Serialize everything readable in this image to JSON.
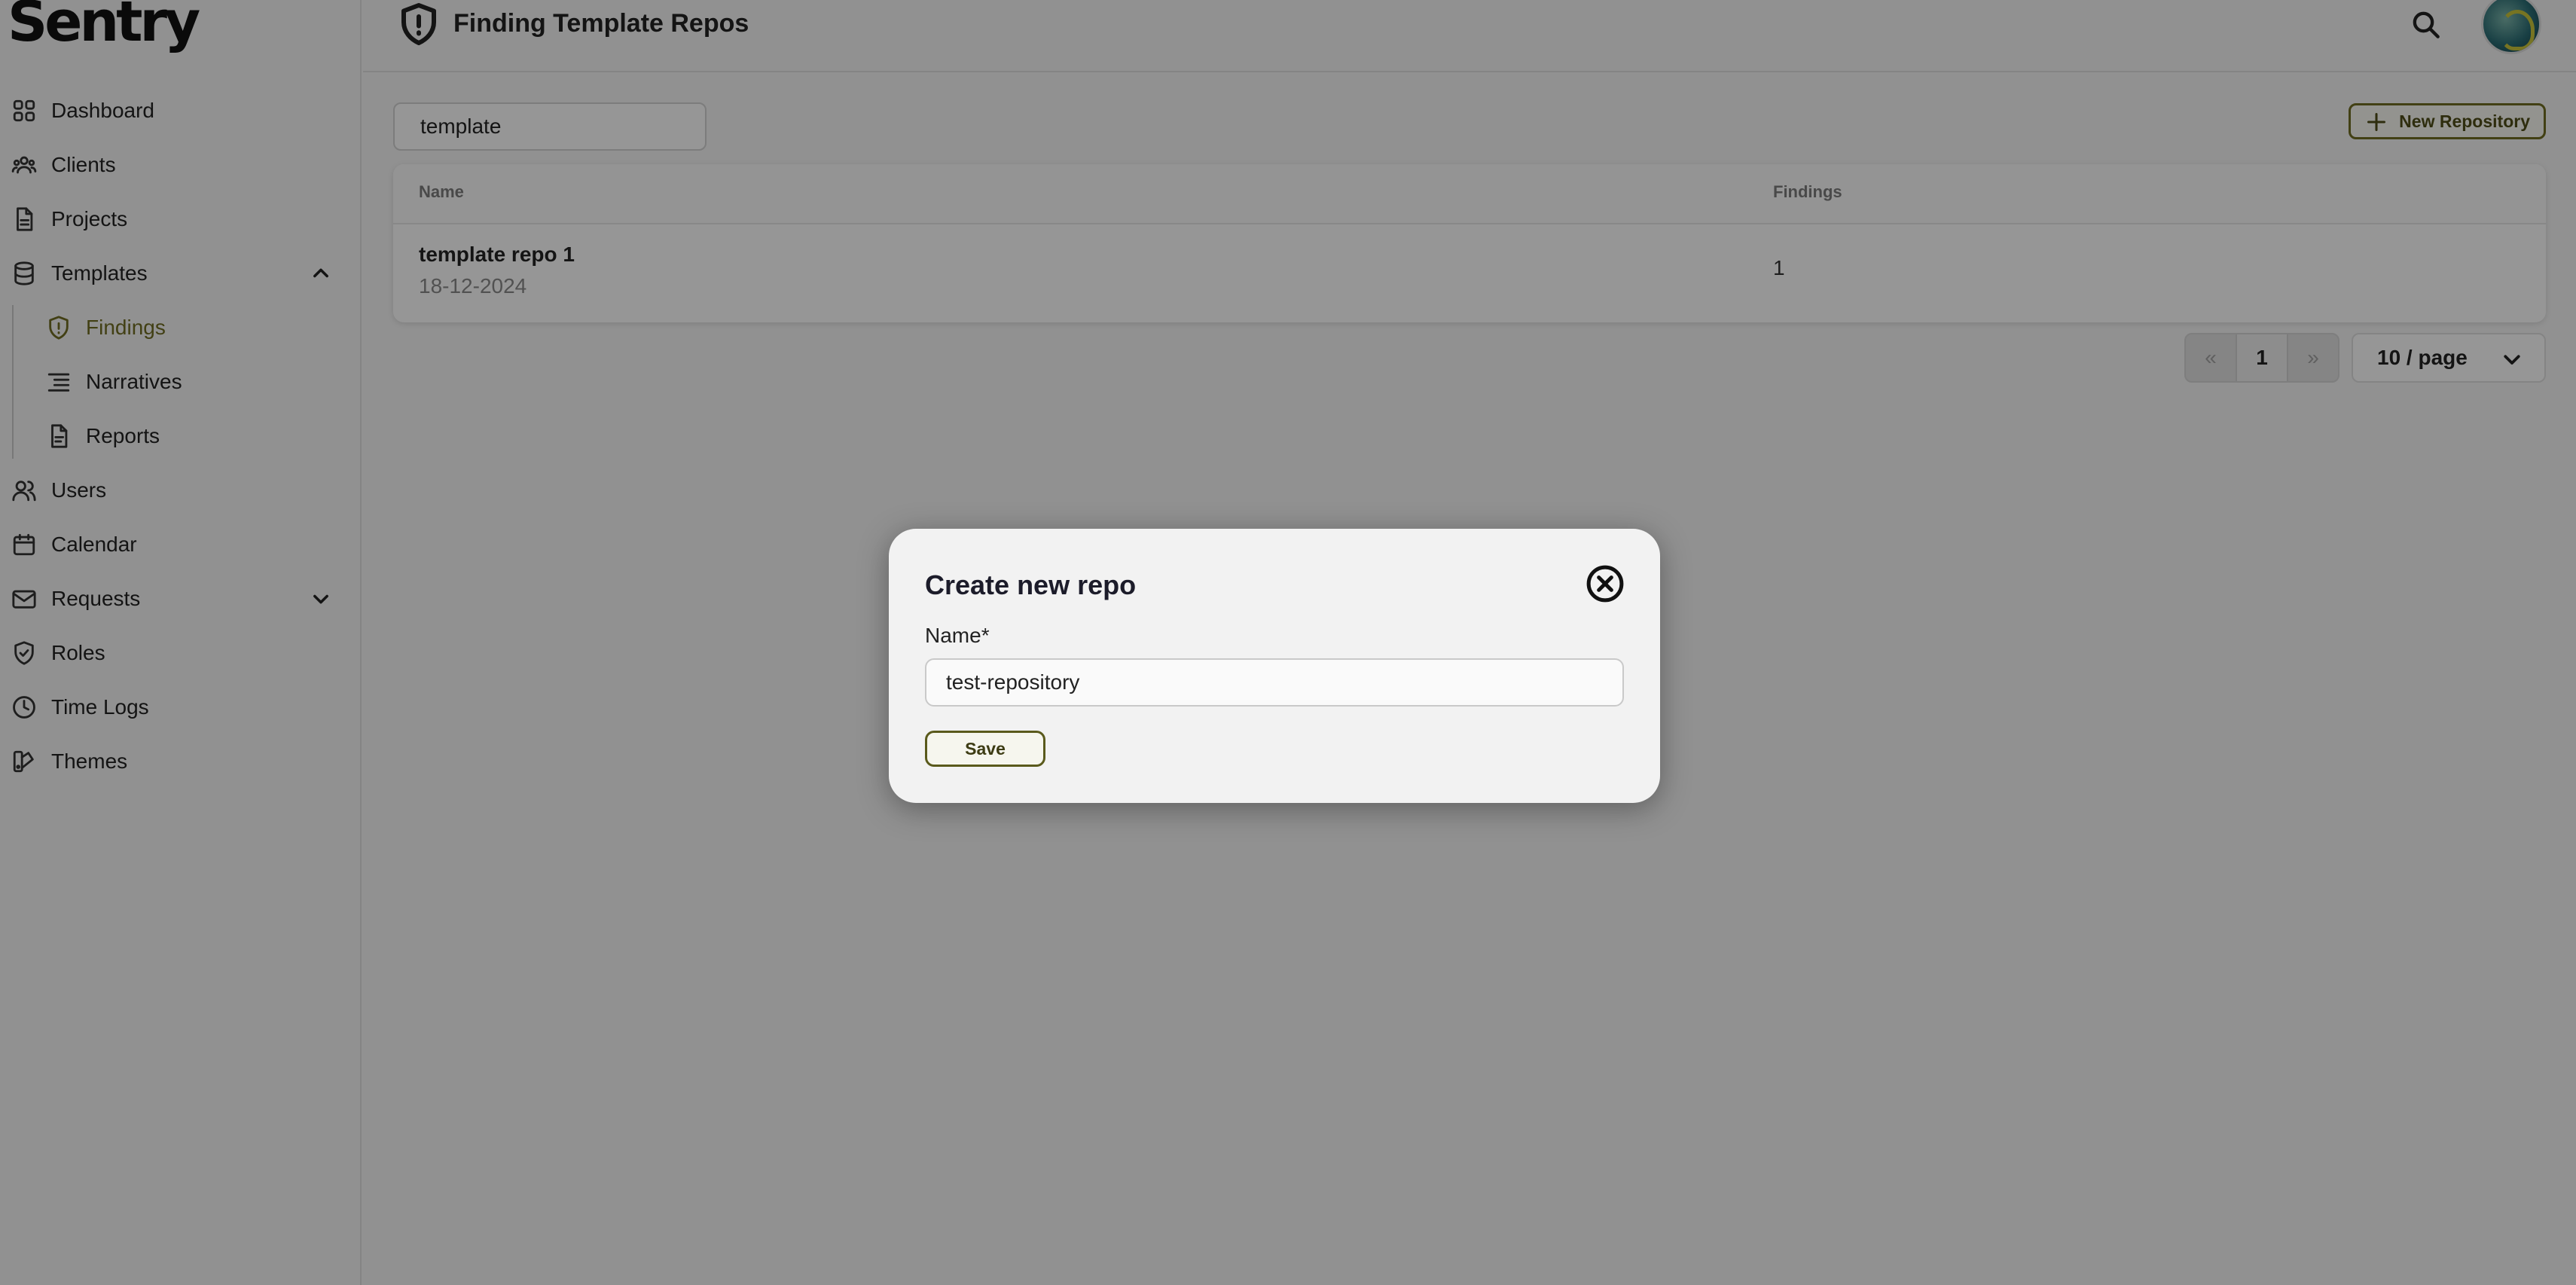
{
  "app": {
    "logo": "Sentry",
    "logo_mark": "™"
  },
  "sidebar": {
    "items": [
      {
        "label": "Dashboard",
        "icon": "grid-icon"
      },
      {
        "label": "Clients",
        "icon": "users-group-icon"
      },
      {
        "label": "Projects",
        "icon": "document-icon"
      },
      {
        "label": "Templates",
        "icon": "database-icon",
        "expanded": true
      },
      {
        "label": "Users",
        "icon": "users-icon"
      },
      {
        "label": "Calendar",
        "icon": "calendar-icon"
      },
      {
        "label": "Requests",
        "icon": "mail-icon",
        "expanded": false
      },
      {
        "label": "Roles",
        "icon": "shield-check-icon"
      },
      {
        "label": "Time Logs",
        "icon": "clock-icon"
      },
      {
        "label": "Themes",
        "icon": "palette-icon"
      }
    ],
    "template_children": [
      {
        "label": "Findings",
        "icon": "shield-alert-icon",
        "active": true
      },
      {
        "label": "Narratives",
        "icon": "list-icon"
      },
      {
        "label": "Reports",
        "icon": "report-icon"
      }
    ]
  },
  "header": {
    "title": "Finding Template Repos",
    "title_icon": "shield-alert-icon"
  },
  "filter": {
    "value": "template"
  },
  "toolbar": {
    "new_repo_label": "New Repository"
  },
  "table": {
    "columns": [
      "Name",
      "Findings"
    ],
    "rows": [
      {
        "name": "template repo 1",
        "date": "18-12-2024",
        "findings": "1"
      }
    ]
  },
  "pagination": {
    "prev": "«",
    "current": "1",
    "next": "»",
    "page_size": "10 / page"
  },
  "modal": {
    "title": "Create new repo",
    "field_label": "Name*",
    "field_value": "test-repository",
    "save_label": "Save"
  },
  "colors": {
    "accent": "#6e6b22",
    "overlay": "rgba(0,0,0,0.40)"
  }
}
